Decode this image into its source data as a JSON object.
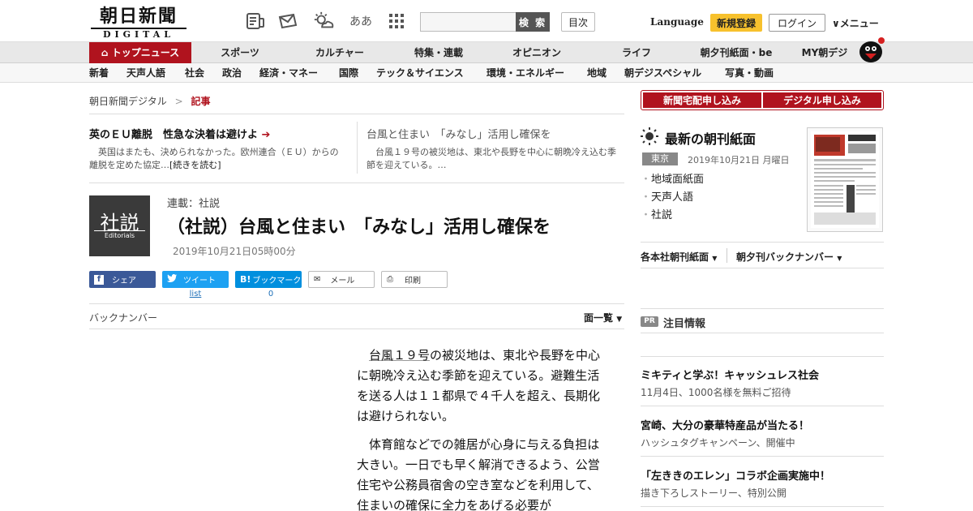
{
  "header": {
    "logo_jp": "朝日新聞",
    "logo_en": "DIGITAL",
    "search_button": "検 索",
    "toc_button": "目次",
    "language": "Language",
    "signup": "新規登録",
    "login": "ログイン",
    "menu": "メニュー",
    "icons": [
      "newspaper-icon",
      "mail-icon",
      "weather-icon",
      "font-size-icon",
      "apps-grid-icon"
    ],
    "font_icon_text": "ああ"
  },
  "nav_primary": [
    {
      "label": "トップニュース",
      "active": true
    },
    {
      "label": "スポーツ"
    },
    {
      "label": "カルチャー"
    },
    {
      "label": "特集・連載"
    },
    {
      "label": "オピニオン"
    },
    {
      "label": "ライフ"
    },
    {
      "label": "朝夕刊紙面・be"
    },
    {
      "label": "MY朝デジ"
    }
  ],
  "nav_secondary": [
    "新着",
    "天声人語",
    "社会",
    "政治",
    "経済・マネー",
    "国際",
    "テック＆サイエンス",
    "環境・エネルギー",
    "地域",
    "朝デジスペシャル",
    "写真・動画"
  ],
  "breadcrumb": {
    "home": "朝日新聞デジタル",
    "sep": ">",
    "current": "記事"
  },
  "related": [
    {
      "title": "英のＥＵ離脱　性急な決着は避けよ",
      "arrow": "➔",
      "body": "英国はまたも、決められなかった。欧州連合（ＥＵ）からの離脱を定めた協定…",
      "more": "[続きを読む]"
    },
    {
      "title": "台風と住まい　「みなし」活用し確保を",
      "body": "台風１９号の被災地は、東北や長野を中心に朝晩冷え込む季節を迎えている。…"
    }
  ],
  "article": {
    "thumb_big": "社説",
    "thumb_small": "Editorials",
    "series": "連載：社説",
    "title": "（社説）台風と住まい　「みなし」活用し確保を",
    "date": "2019年10月21日05時00分",
    "share": {
      "facebook": "シェア",
      "twitter": "ツイート",
      "twitter_count": "list",
      "hatena": "ブックマーク",
      "hatena_mark": "B!",
      "hatena_count": "0",
      "mail": "メール",
      "print": "印刷"
    },
    "backnumber": "バックナンバー",
    "index": "面一覧",
    "paragraphs": [
      {
        "link": "台風１９号",
        "text": "の被災地は、東北や長野を中心に朝晩冷え込む季節を迎えている。避難生活を送る人は１１都県で４千人を超え、長期化は避けられない。"
      },
      {
        "link": "",
        "text": "体育館などでの雑居が心身に与える負担は大きい。一日でも早く解消できるよう、公営住宅や公務員宿舎の空き室などを利用して、住まいの確保に全力をあげる必要が"
      }
    ]
  },
  "sidebar": {
    "buttons": [
      "新聞宅配申し込み",
      "デジタル申し込み"
    ],
    "paper_title": "最新の朝刊紙面",
    "region": "東京",
    "paper_date": "2019年10月21日 月曜日",
    "paper_links": [
      "地域面紙面",
      "天声人語",
      "社説"
    ],
    "dropdowns": [
      "各本社朝刊紙面",
      "朝夕刊バックナンバー"
    ],
    "pr_badge": "PR",
    "pr_title": "注目情報",
    "pr_items": [
      {
        "title": "ミキティと学ぶ！キャッシュレス社会",
        "sub": "11月4日、1000名様を無料ご招待"
      },
      {
        "title": "宮崎、大分の豪華特産品が当たる！",
        "sub": "ハッシュタグキャンペーン、開催中"
      },
      {
        "title": "「左ききのエレン」コラボ企画実施中！",
        "sub": "描き下ろしストーリー、特別公開"
      }
    ]
  },
  "colors": {
    "brand_red": "#b0131e",
    "signup_yellow": "#f7c12d",
    "facebook": "#3b5998",
    "twitter": "#1da1f2",
    "hatena": "#008fde"
  }
}
